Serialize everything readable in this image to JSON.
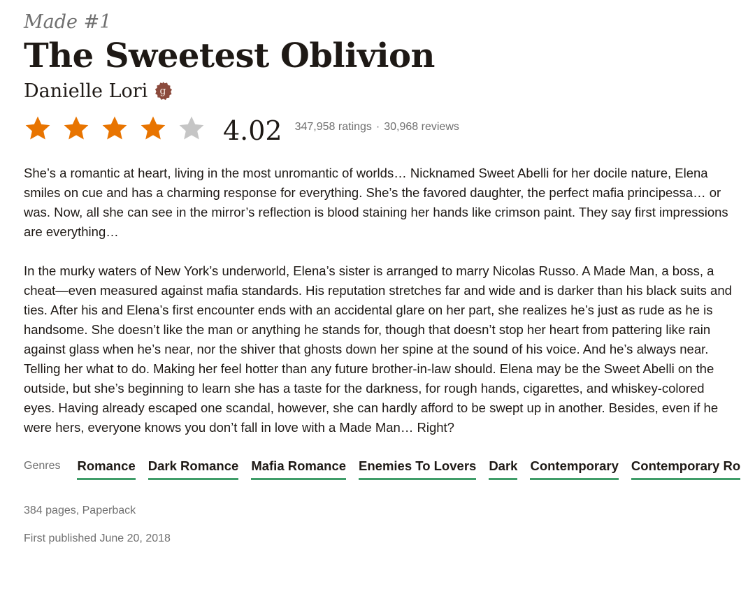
{
  "book": {
    "series": "Made #1",
    "title": "The Sweetest Oblivion",
    "author": "Danielle Lori",
    "author_badge_icon": "goodreads-author-icon",
    "rating": {
      "value": "4.02",
      "stars_filled": 4,
      "stars_total": 5,
      "ratings_text": "347,958 ratings",
      "separator": "·",
      "reviews_text": "30,968 reviews"
    },
    "description": [
      "She’s a romantic at heart, living in the most unromantic of worlds… Nicknamed Sweet Abelli for her docile nature, Elena smiles on cue and has a charming response for everything. She’s the favored daughter, the perfect mafia principessa… or was. Now, all she can see in the mirror’s reflection is blood staining her hands like crimson paint. They say first impressions are everything…",
      "In the murky waters of New York’s underworld, Elena’s sister is arranged to marry Nicolas Russo. A Made Man, a boss, a cheat—even measured against mafia standards. His reputation stretches far and wide and is darker than his black suits and ties. After his and Elena’s first encounter ends with an accidental glare on her part, she realizes he’s just as rude as he is handsome. She doesn’t like the man or anything he stands for, though that doesn’t stop her heart from pattering like rain against glass when he’s near, nor the shiver that ghosts down her spine at the sound of his voice. And he’s always near. Telling her what to do. Making her feel hotter than any future brother-in-law should. Elena may be the Sweet Abelli on the outside, but she’s beginning to learn she has a taste for the darkness, for rough hands, cigarettes, and whiskey-colored eyes. Having already escaped one scandal, however, she can hardly afford to be swept up in another. Besides, even if he were hers, everyone knows you don’t fall in love with a Made Man… Right?"
    ],
    "genres_label": "Genres",
    "genres": [
      "Romance",
      "Dark Romance",
      "Mafia Romance",
      "Enemies To Lovers",
      "Dark",
      "Contemporary",
      "Contemporary Ro"
    ],
    "pages_format": "384 pages, Paperback",
    "first_published": "First published June 20, 2018"
  },
  "colors": {
    "star_filled": "#e87400",
    "star_empty": "#c5c5c5",
    "genre_underline": "#409d69",
    "badge": "#8b4a3c",
    "text_primary": "#1e1915",
    "text_secondary": "#707070"
  }
}
